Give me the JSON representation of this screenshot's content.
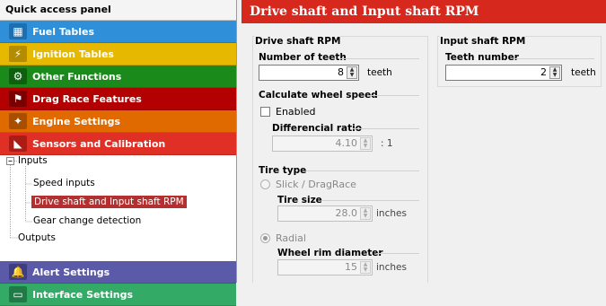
{
  "panel": {
    "title": "Quick access panel",
    "categories": [
      {
        "label": "Fuel Tables",
        "color": "#2f8fd8",
        "icon": "fuel-table-icon"
      },
      {
        "label": "Ignition Tables",
        "color": "#e6b800",
        "icon": "ignition-icon"
      },
      {
        "label": "Other Functions",
        "color": "#1a8a1a",
        "icon": "other-functions-icon"
      },
      {
        "label": "Drag Race Features",
        "color": "#b30000",
        "icon": "drag-race-icon"
      },
      {
        "label": "Engine Settings",
        "color": "#e06a00",
        "icon": "engine-icon"
      },
      {
        "label": "Sensors and Calibration",
        "color": "#e02f24",
        "icon": "sensors-icon"
      },
      {
        "label": "Alert Settings",
        "color": "#5a5aa8",
        "icon": "alert-icon"
      },
      {
        "label": "Interface Settings",
        "color": "#33aa66",
        "icon": "interface-icon"
      }
    ],
    "tree": {
      "inputs": "Inputs",
      "speed_inputs": "Speed inputs",
      "drive_shaft": "Drive shaft and Input shaft RPM",
      "gear_change": "Gear change detection",
      "outputs": "Outputs"
    }
  },
  "main": {
    "title": "Drive shaft and Input shaft RPM",
    "drive_shaft": {
      "title": "Drive shaft RPM",
      "teeth_label": "Number of teeth",
      "teeth_value": "8",
      "teeth_unit": "teeth"
    },
    "input_shaft": {
      "title": "Input shaft RPM",
      "teeth_label": "Teeth number",
      "teeth_value": "2",
      "teeth_unit": "teeth"
    },
    "wheel_speed": {
      "title": "Calculate wheel speed",
      "enabled_label": "Enabled",
      "enabled": false,
      "diff_label": "Differencial ratio",
      "diff_value": "4.10",
      "diff_unit": ": 1"
    },
    "tire": {
      "title": "Tire type",
      "slick_label": "Slick / DragRace",
      "tire_size_label": "Tire size",
      "tire_size_value": "28.0",
      "tire_size_unit": "inches",
      "radial_label": "Radial",
      "rim_label": "Wheel rim diameter",
      "rim_value": "15",
      "rim_unit": "inches"
    }
  }
}
